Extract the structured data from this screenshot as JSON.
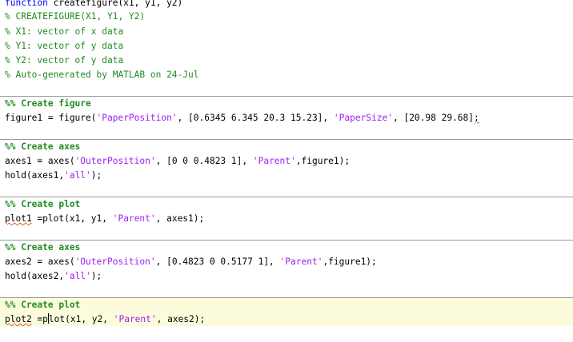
{
  "colors": {
    "keyword": "#0000ff",
    "comment": "#228b22",
    "string": "#a020f0",
    "active_cell_bg": "#fcfcdc"
  },
  "code": {
    "l1_kw": "function",
    "l1_rest": " createfigure(x1, y1, y2)",
    "l2": "% CREATEFIGURE(X1, Y1, Y2)",
    "l3": "% X1: vector of x data",
    "l4": "% Y1: vector of y data",
    "l5": "% Y2: vector of y data",
    "l6": "% Auto-generated by MATLAB on 24-Jul",
    "c1_head": "%% Create figure",
    "c1_a": "figure1 = figure(",
    "c1_s1": "'PaperPosition'",
    "c1_b": ", [0.6345 6.345 20.3 15.23], ",
    "c1_s2": "'PaperSize'",
    "c1_c": ", [20.98 29.68]",
    "c1_d": ";",
    "c2_head": "%% Create axes",
    "c2_a": "axes1 = axes(",
    "c2_s1": "'OuterPosition'",
    "c2_b": ", [0 0 0.4823 1], ",
    "c2_s2": "'Parent'",
    "c2_c": ",figure1);",
    "c2_h1": "hold(axes1,",
    "c2_h2": "'all'",
    "c2_h3": ");",
    "c3_head": "%% Create plot",
    "c3_a": "plot1",
    "c3_b": " =plot(x1, y1, ",
    "c3_s1": "'Parent'",
    "c3_c": ", axes1);",
    "c4_head": "%% Create axes",
    "c4_a": "axes2 = axes(",
    "c4_s1": "'OuterPosition'",
    "c4_b": ", [0.4823 0 0.5177 1], ",
    "c4_s2": "'Parent'",
    "c4_c": ",figure1);",
    "c4_h1": "hold(axes2,",
    "c4_h2": "'all'",
    "c4_h3": ");",
    "c5_head": "%% Create plot",
    "c5_a": "plot2",
    "c5_b": " =p",
    "c5_b2": "lot(x1, y2, ",
    "c5_s1": "'Parent'",
    "c5_c": ", axes2);"
  }
}
